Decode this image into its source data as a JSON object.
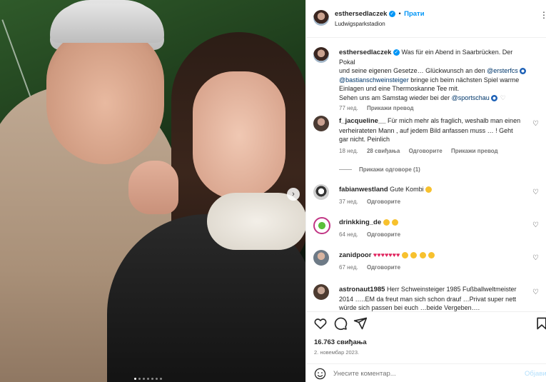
{
  "header": {
    "username": "esthersedlaczek",
    "separator": "•",
    "follow_label": "Прати",
    "location": "Ludwigsparkstadion"
  },
  "caption": {
    "username": "esthersedlaczek",
    "line1": "Was für ein Abend in Saarbrücken. Der Pokal",
    "line2a": "und seine eigenen Gesetze… Glückwunsch an den ",
    "mention1": "@ersterfcs",
    "mention2": "@bastianschweinsteiger",
    "line3b": " bringe ich beim nächsten Spiel warme",
    "line4": "Einlagen und eine Thermoskanne Tee mit.",
    "line5a": "Sehen uns am Samstag wieder bei der ",
    "mention3": "@sportschau",
    "age": "77 нед.",
    "translate": "Прикажи превод"
  },
  "comments": [
    {
      "username": "f_jacqueline__",
      "text1": "Für mich mehr als fraglich, weshalb man einen",
      "text2": "verheirateten Mann , auf jedem Bild anfassen muss … ! Geht",
      "text3": "gar nicht. Peinlich",
      "age": "18 нед.",
      "likes": "28 свиђања",
      "reply": "Одговорите",
      "translate": "Прикажи превод",
      "replies_toggle": "Прикажи одговоре (1)"
    },
    {
      "username": "fabianwestland",
      "text1": "Gute Kombi",
      "age": "37 нед.",
      "reply": "Одговорите"
    },
    {
      "username": "drinkking_de",
      "text1": "",
      "age": "64 нед.",
      "reply": "Одговорите"
    },
    {
      "username": "zanidpoor",
      "text1": "",
      "age": "67 нед.",
      "reply": "Одговорите"
    },
    {
      "username": "astronaut1985",
      "text1": "Herr Schweinsteiger 1985 Fußballweltmeister",
      "text2": "2014 …..EM da freut man sich schon drauf …Privat super nett",
      "text3": "würde sich passen bei euch …beide Vergeben…."
    }
  ],
  "footer": {
    "likes": "16.763 свиђања",
    "date": "2. новембар 2023.",
    "comment_placeholder": "Унесите коментар...",
    "post_label": "Објави"
  },
  "icons": {
    "heart": "heart-icon",
    "comment": "comment-icon",
    "share": "share-icon",
    "save": "bookmark-icon",
    "emoji": "emoji-icon",
    "more": "more-icon"
  },
  "colors": {
    "accent": "#0095f6",
    "link": "#00376b",
    "muted": "#737373"
  }
}
